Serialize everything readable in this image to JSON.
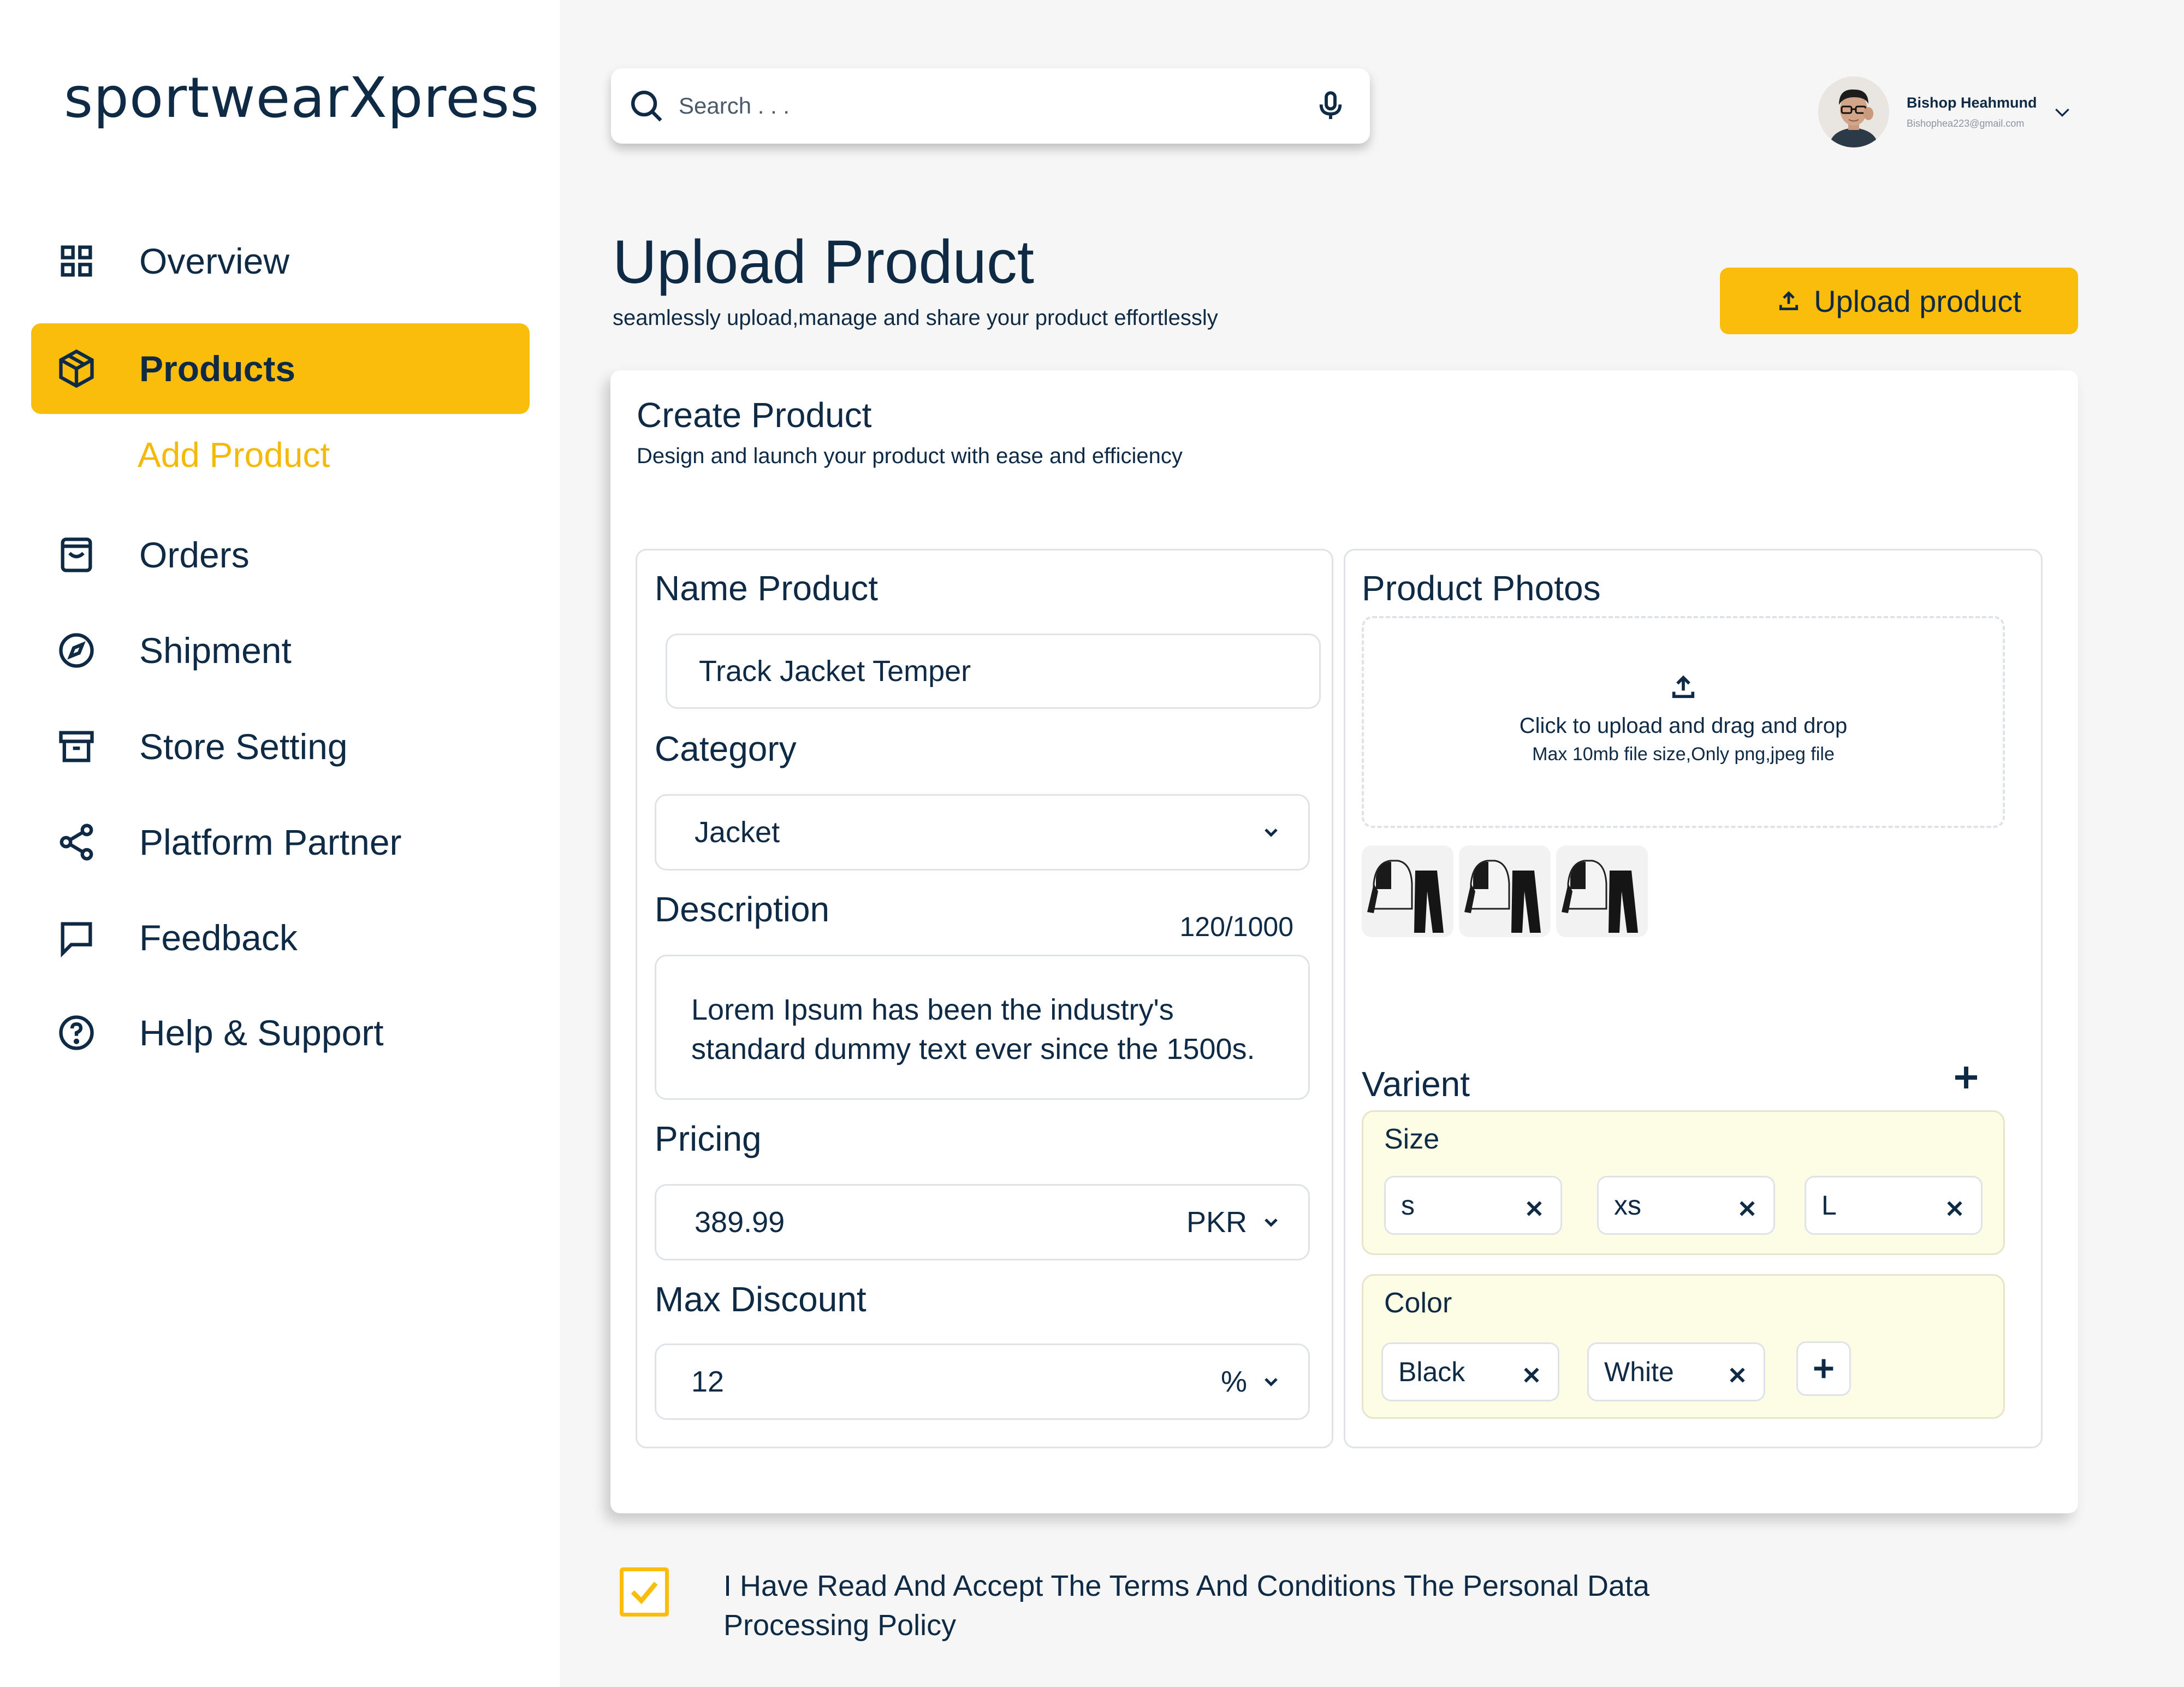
{
  "brand": "sportwearXpress",
  "sidebar": {
    "items": [
      {
        "label": "Overview",
        "icon": "grid-icon"
      },
      {
        "label": "Products",
        "icon": "box-icon",
        "active": true
      },
      {
        "label": "Orders",
        "icon": "shopping-bag-icon"
      },
      {
        "label": "Shipment",
        "icon": "compass-icon"
      },
      {
        "label": "Store Setting",
        "icon": "archive-icon"
      },
      {
        "label": "Platform Partner",
        "icon": "share-icon"
      },
      {
        "label": "Feedback",
        "icon": "message-icon"
      },
      {
        "label": "Help & Support",
        "icon": "help-circle-icon"
      }
    ],
    "sub_item": "Add Product"
  },
  "header": {
    "search_placeholder": "Search . . .",
    "user_name": "Bishop Heahmund",
    "user_email": "Bishophea223@gmail.com"
  },
  "page": {
    "title": "Upload Product",
    "subtitle": "seamlessly upload,manage and share your product effortlessly",
    "upload_button": "Upload product"
  },
  "card": {
    "title": "Create Product",
    "subtitle": "Design and launch your product with ease and efficiency"
  },
  "form": {
    "name_label": "Name Product",
    "name_value": "Track Jacket Temper",
    "category_label": "Category",
    "category_value": "Jacket",
    "description_label": "Description",
    "description_counter": "120/1000",
    "description_value": "Lorem Ipsum has been the industry's standard dummy text ever since the 1500s.",
    "pricing_label": "Pricing",
    "price_value": "389.99",
    "currency": "PKR",
    "discount_label": "Max Discount",
    "discount_value": "12",
    "discount_unit": "%"
  },
  "photos": {
    "title": "Product Photos",
    "upload_title": "Click to upload and drag and drop",
    "upload_hint": "Max 10mb file size,Only png,jpeg file",
    "thumbnail_count": 3
  },
  "variant": {
    "title": "Varient",
    "size_label": "Size",
    "sizes": [
      "s",
      "xs",
      "L"
    ],
    "color_label": "Color",
    "colors": [
      "Black",
      "White"
    ]
  },
  "terms": {
    "text": "I Have Read And Accept The Terms And Conditions The Personal Data Processing Policy",
    "checked": true
  },
  "colors": {
    "accent": "#FBBD0C",
    "text": "#0F2A44",
    "main_bg": "#F6F6F6",
    "variant_bg": "#FDFDE6"
  }
}
